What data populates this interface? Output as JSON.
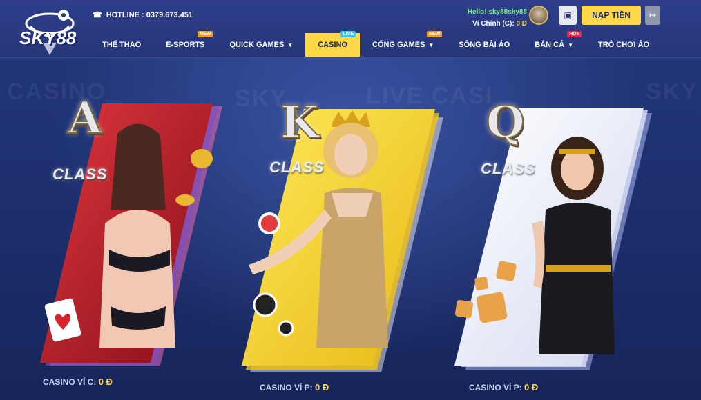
{
  "header": {
    "brand": "SKY88",
    "hotline": "HOTLINE : 0379.673.451",
    "user_greeting": "Hello! sky88sky88",
    "wallet_label": "Ví Chính (C):",
    "wallet_value": "0 Đ",
    "deposit_label": "NẠP TIỀN"
  },
  "nav": {
    "items": [
      {
        "label": "THỂ THAO"
      },
      {
        "label": "E-SPORTS",
        "badge": "NEW"
      },
      {
        "label": "QUICK GAMES"
      },
      {
        "label": "CASINO",
        "badge": "LIVE"
      },
      {
        "label": "CỔNG GAMES",
        "badge": "NEW"
      },
      {
        "label": "SÒNG BÀI ẢO"
      },
      {
        "label": "BẮN CÁ",
        "badge": "HOT"
      },
      {
        "label": "TRÒ CHƠI ẢO"
      }
    ],
    "active": "CASINO"
  },
  "background_words": [
    "CASINO",
    "SKY",
    "LIVE CASI",
    "SKY"
  ],
  "cards": [
    {
      "letter": "A",
      "class_label": "CLASS",
      "balance_label": "CASINO VÍ C:",
      "balance_value": "0 Đ",
      "color": "#c81d2a"
    },
    {
      "letter": "K",
      "class_label": "CLASS",
      "balance_label": "CASINO VÍ P:",
      "balance_value": "0 Đ",
      "color": "#f6d32a"
    },
    {
      "letter": "Q",
      "class_label": "CLASS",
      "balance_label": "CASINO VÍ P:",
      "balance_value": "0 Đ",
      "color": "#eef0f8"
    }
  ],
  "icons": {
    "hotline": "headset-icon",
    "wallet": "wallet-icon",
    "logout": "logout-icon",
    "caret": "chevron-down-icon"
  },
  "colors": {
    "accent": "#ffd84a",
    "header_bg": "#2e3f8c",
    "greeting": "#7cf08a"
  }
}
